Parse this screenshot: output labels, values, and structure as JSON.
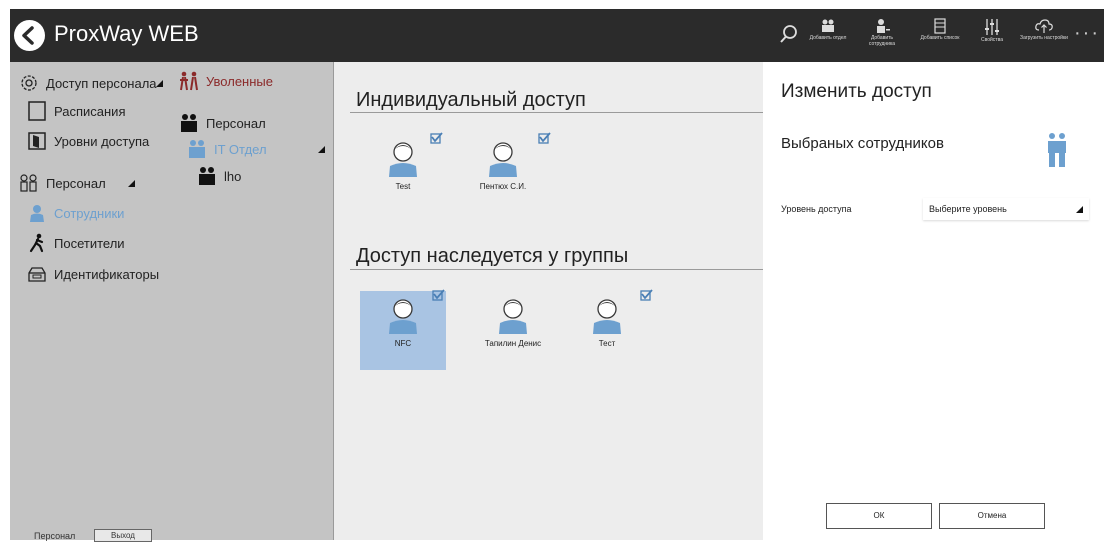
{
  "app": {
    "title": "ProxWay WEB"
  },
  "toolbar": {
    "buttons": [
      {
        "label": "Добавить отдел",
        "icon": "add-department-icon"
      },
      {
        "label": "Добавить сотрудника",
        "icon": "add-employee-icon"
      },
      {
        "label": "Добавить список",
        "icon": "add-list-icon"
      },
      {
        "label": "Свойства",
        "icon": "properties-icon"
      },
      {
        "label": "Загрузить настройки",
        "icon": "upload-settings-icon"
      }
    ],
    "more": "···"
  },
  "sidebar": {
    "access_group": "Доступ персонала",
    "schedules": "Расписания",
    "access_levels": "Уровни доступа",
    "personnel_group": "Персонал",
    "employees": "Сотрудники",
    "visitors": "Посетители",
    "identifiers": "Идентификаторы"
  },
  "tree": {
    "fired": "Уволенные",
    "personnel": "Персонал",
    "it_dept": "IT Отдел",
    "lho": "lho"
  },
  "main": {
    "individual_title": "Индивидуальный доступ",
    "individual_people": [
      "Test",
      "Пентюх С.И."
    ],
    "inherited_title": "Доступ наследуется у группы",
    "inherited_people": [
      "NFC",
      "Тапилин Денис",
      "Тест"
    ]
  },
  "right_panel": {
    "title": "Изменить доступ",
    "subtitle": "Выбраных сотрудников",
    "level_label": "Уровень доступа",
    "level_placeholder": "Выберите уровень",
    "ok": "ОК",
    "cancel": "Отмена"
  },
  "bottom": {
    "label": "Персонал",
    "logout": "Выход"
  },
  "colors": {
    "accent": "#6da0cf",
    "fired": "#8b2a2a",
    "topbar": "#2b2b2b",
    "selection": "#a9c4e3"
  }
}
